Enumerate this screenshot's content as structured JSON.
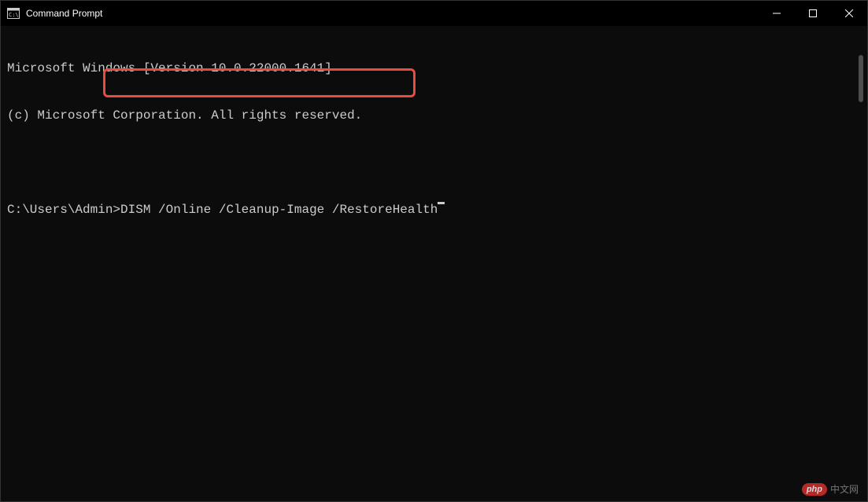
{
  "titlebar": {
    "title": "Command Prompt"
  },
  "terminal": {
    "header_line1": "Microsoft Windows [Version 10.0.22000.1641]",
    "header_line2": "(c) Microsoft Corporation. All rights reserved.",
    "prompt": "C:\\Users\\Admin>",
    "command": "DISM /Online /Cleanup-Image /RestoreHealth"
  },
  "watermark": {
    "badge": "php",
    "text": "中文网"
  }
}
